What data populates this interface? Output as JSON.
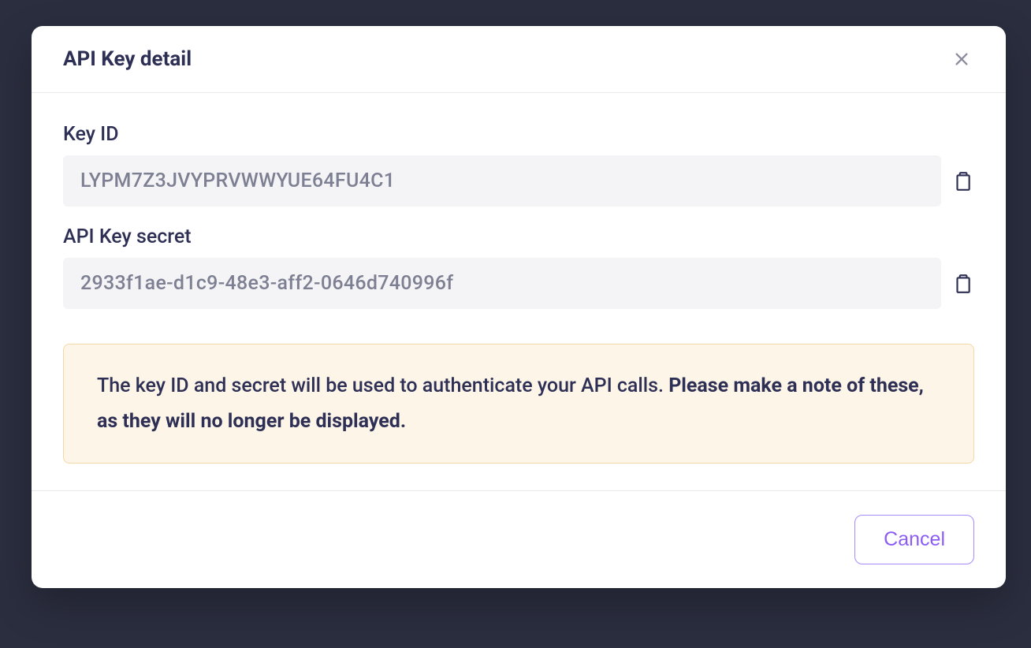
{
  "modal": {
    "title": "API Key detail",
    "fields": {
      "key_id": {
        "label": "Key ID",
        "value": "LYPM7Z3JVYPRVWWYUE64FU4C1"
      },
      "api_key_secret": {
        "label": "API Key secret",
        "value": "2933f1ae-d1c9-48e3-aff2-0646d740996f"
      }
    },
    "notice": {
      "text_normal": "The key ID and secret will be used to authenticate your API calls. ",
      "text_bold": "Please make a note of these, as they will no longer be displayed."
    },
    "buttons": {
      "cancel": "Cancel"
    }
  }
}
